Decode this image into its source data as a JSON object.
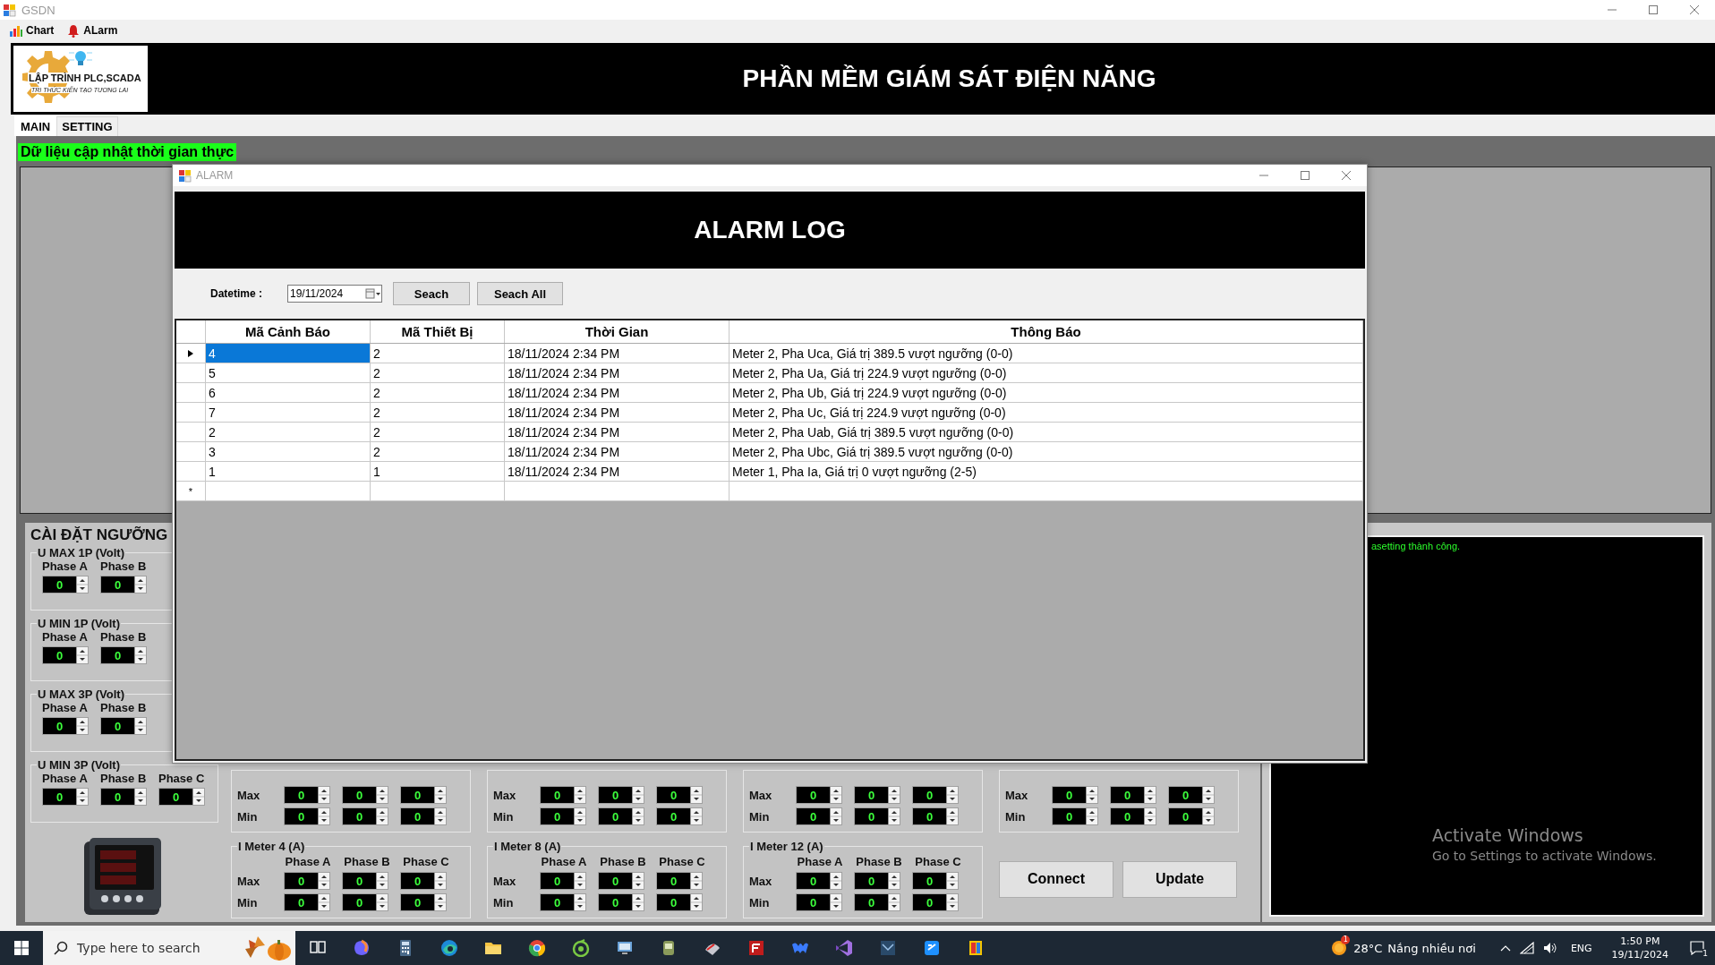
{
  "window": {
    "title": "GSDN"
  },
  "menu": [
    {
      "label": "Chart"
    },
    {
      "label": "ALarm"
    }
  ],
  "header": {
    "logo": {
      "title": "LẬP TRÌNH PLC,SCADA",
      "slogan": "TRI THỨC KIẾN TẠO TƯƠNG LAI"
    },
    "title": "PHẦN MỀM GIÁM SÁT ĐIỆN NĂNG"
  },
  "tabs": [
    {
      "label": "MAIN",
      "selected": true
    },
    {
      "label": "SETTING",
      "selected": false
    }
  ],
  "realtime_label": "Dữ liệu cập nhật thời gian thực",
  "settings": {
    "title": "CÀI ĐẶT NGƯỠNG",
    "voltage_groups": [
      {
        "title": "U MAX 1P (Volt)",
        "phases": [
          {
            "label": "Phase A",
            "value": "0"
          },
          {
            "label": "Phase B",
            "value": "0"
          }
        ]
      },
      {
        "title": "U MIN 1P (Volt)",
        "phases": [
          {
            "label": "Phase A",
            "value": "0"
          },
          {
            "label": "Phase B",
            "value": "0"
          }
        ]
      },
      {
        "title": "U MAX 3P (Volt)",
        "phases": [
          {
            "label": "Phase A",
            "value": "0"
          },
          {
            "label": "Phase B",
            "value": "0"
          }
        ]
      },
      {
        "title": "U MIN 3P (Volt)",
        "phases": [
          {
            "label": "Phase A",
            "value": "0"
          },
          {
            "label": "Phase B",
            "value": "0"
          },
          {
            "label": "Phase C",
            "value": "0"
          }
        ]
      }
    ],
    "meter_groups_top": [
      {
        "rows": [
          {
            "label": "Max",
            "values": [
              "0",
              "0",
              "0"
            ]
          },
          {
            "label": "Min",
            "values": [
              "0",
              "0",
              "0"
            ]
          }
        ]
      },
      {
        "rows": [
          {
            "label": "Max",
            "values": [
              "0",
              "0",
              "0"
            ]
          },
          {
            "label": "Min",
            "values": [
              "0",
              "0",
              "0"
            ]
          }
        ]
      },
      {
        "rows": [
          {
            "label": "Max",
            "values": [
              "0",
              "0",
              "0"
            ]
          },
          {
            "label": "Min",
            "values": [
              "0",
              "0",
              "0"
            ]
          }
        ]
      },
      {
        "rows": [
          {
            "label": "Max",
            "values": [
              "0",
              "0",
              "0"
            ]
          },
          {
            "label": "Min",
            "values": [
              "0",
              "0",
              "0"
            ]
          }
        ]
      }
    ],
    "meter_groups": [
      {
        "title": "I Meter 4 (A)",
        "phases": [
          "Phase A",
          "Phase B",
          "Phase C"
        ],
        "rows": [
          {
            "label": "Max",
            "values": [
              "0",
              "0",
              "0"
            ]
          },
          {
            "label": "Min",
            "values": [
              "0",
              "0",
              "0"
            ]
          }
        ]
      },
      {
        "title": "I Meter 8 (A)",
        "phases": [
          "Phase A",
          "Phase B",
          "Phase C"
        ],
        "rows": [
          {
            "label": "Max",
            "values": [
              "0",
              "0",
              "0"
            ]
          },
          {
            "label": "Min",
            "values": [
              "0",
              "0",
              "0"
            ]
          }
        ]
      },
      {
        "title": "I Meter 12 (A)",
        "phases": [
          "Phase A",
          "Phase B",
          "Phase C"
        ],
        "rows": [
          {
            "label": "Max",
            "values": [
              "0",
              "0",
              "0"
            ]
          },
          {
            "label": "Min",
            "values": [
              "0",
              "0",
              "0"
            ]
          }
        ]
      }
    ],
    "buttons": [
      "Connect",
      "Update"
    ]
  },
  "log": {
    "lines": [
      "asetting thành công."
    ]
  },
  "activation": {
    "title": "Activate Windows",
    "message": "Go to Settings to activate Windows."
  },
  "alarm_window": {
    "title": "ALARM",
    "heading": "ALARM LOG",
    "datetime_label": "Datetime :",
    "date": "19/11/2024",
    "buttons": [
      "Seach",
      "Seach All"
    ],
    "table": {
      "columns": [
        "Mã Cảnh Báo",
        "Mã Thiết Bị",
        "Thời Gian",
        "Thông Báo"
      ],
      "rows": [
        {
          "cells": [
            "4",
            "2",
            "18/11/2024 2:34 PM",
            "Meter 2, Pha Uca, Giá trị 389.5 vượt ngưỡng (0-0)"
          ],
          "selected": true
        },
        {
          "cells": [
            "5",
            "2",
            "18/11/2024 2:34 PM",
            "Meter 2, Pha Ua, Giá trị 224.9 vượt ngưỡng (0-0)"
          ],
          "selected": false
        },
        {
          "cells": [
            "6",
            "2",
            "18/11/2024 2:34 PM",
            "Meter 2, Pha Ub, Giá trị 224.9 vượt ngưỡng (0-0)"
          ],
          "selected": false
        },
        {
          "cells": [
            "7",
            "2",
            "18/11/2024 2:34 PM",
            "Meter 2, Pha Uc, Giá trị 224.9 vượt ngưỡng (0-0)"
          ],
          "selected": false
        },
        {
          "cells": [
            "2",
            "2",
            "18/11/2024 2:34 PM",
            "Meter 2, Pha Uab, Giá trị 389.5 vượt ngưỡng (0-0)"
          ],
          "selected": false
        },
        {
          "cells": [
            "3",
            "2",
            "18/11/2024 2:34 PM",
            "Meter 2, Pha Ubc, Giá trị 389.5 vượt ngưỡng (0-0)"
          ],
          "selected": false
        },
        {
          "cells": [
            "1",
            "1",
            "18/11/2024 2:34 PM",
            "Meter 1, Pha Ia, Giá trị 0 vượt ngưỡng (2-5)"
          ],
          "selected": false
        }
      ],
      "new_row_marker": "*"
    }
  },
  "taskbar": {
    "search_placeholder": "Type here to search",
    "weather": {
      "badge": "1",
      "temperature": "28°C",
      "condition": "Nắng nhiều nơi"
    },
    "language": "ENG",
    "time": "1:50 PM",
    "date": "19/11/2024",
    "notifications": "1"
  }
}
